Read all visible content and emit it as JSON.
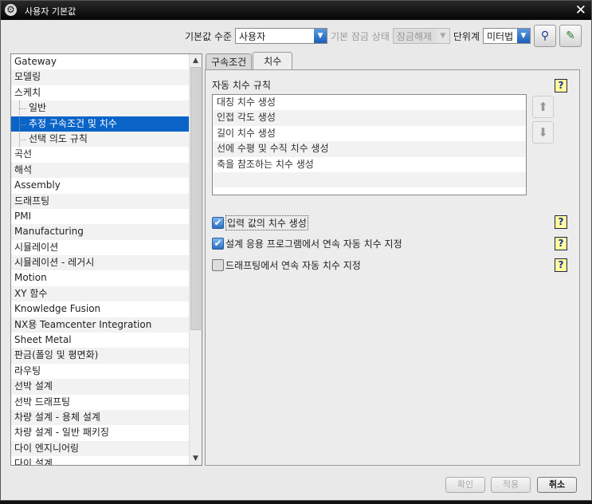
{
  "window": {
    "title": "사용자 기본값"
  },
  "toolbar": {
    "default_level_label": "기본값 수준",
    "default_level_value": "사용자",
    "lock_state_label": "기본 잠금 상태",
    "lock_state_value": "잠금해제",
    "units_label": "단위계",
    "units_value": "미터법"
  },
  "tree": {
    "items": [
      {
        "label": "Gateway"
      },
      {
        "label": "모델링"
      },
      {
        "label": "스케치"
      },
      {
        "label": "일반",
        "child": true
      },
      {
        "label": "추정 구속조건 및 치수",
        "child": true,
        "selected": true
      },
      {
        "label": "선택 의도 규칙",
        "child": true
      },
      {
        "label": "곡선"
      },
      {
        "label": "해석"
      },
      {
        "label": "Assembly"
      },
      {
        "label": "드래프팅"
      },
      {
        "label": "PMI"
      },
      {
        "label": "Manufacturing"
      },
      {
        "label": "시뮬레이션"
      },
      {
        "label": "시뮬레이션 - 레거시"
      },
      {
        "label": "Motion"
      },
      {
        "label": "XY 함수"
      },
      {
        "label": "Knowledge Fusion"
      },
      {
        "label": "NX용 Teamcenter Integration"
      },
      {
        "label": "Sheet Metal"
      },
      {
        "label": "판금(폴잉 및 평면화)"
      },
      {
        "label": "라우팅"
      },
      {
        "label": "선박 설계"
      },
      {
        "label": "선박 드래프팅"
      },
      {
        "label": "차량 설계 - 용체 설계"
      },
      {
        "label": "차량 설계 - 일반 패키징"
      },
      {
        "label": "다이 엔지니어링"
      },
      {
        "label": "다이 설계"
      }
    ]
  },
  "tabs": [
    {
      "label": "구속조건"
    },
    {
      "label": "치수",
      "active": true
    }
  ],
  "panel": {
    "section_title": "자동 치수 규칙",
    "rules": [
      "대칭 치수 생성",
      "인접 각도 생성",
      "길이 치수 생성",
      "선에 수평 및 수직 치수 생성",
      "축을 참조하는 치수 생성"
    ],
    "options": [
      {
        "label": "입력 값의 치수 생성",
        "checked": true
      },
      {
        "label": "설계 응용 프로그램에서 연속 자동 치수 지정",
        "checked": true
      },
      {
        "label": "드래프팅에서 연속 자동 치수 지정",
        "checked": false
      }
    ],
    "help_glyph": "?"
  },
  "buttons": {
    "ok": "확인",
    "apply": "적용",
    "cancel": "취소"
  }
}
